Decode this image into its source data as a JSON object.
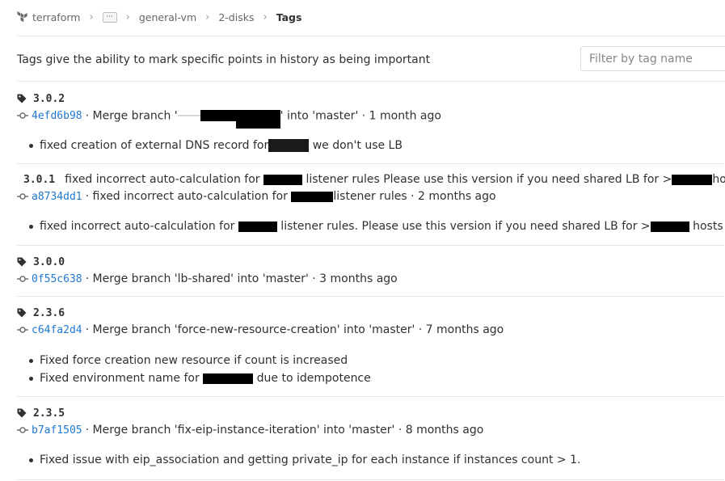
{
  "breadcrumb": {
    "root": "terraform",
    "more": "···",
    "items": [
      "general-vm",
      "2-disks"
    ],
    "current": "Tags"
  },
  "intro": "Tags give the ability to mark specific points in history as being important",
  "filter": {
    "placeholder": "Filter by tag name",
    "value": ""
  },
  "tags": [
    {
      "name": "3.0.2",
      "message": "",
      "sha": "4efd6b98",
      "commit_pre": "· Merge branch '",
      "commit_post": "' into 'master' · 1 month ago",
      "notes": [
        {
          "pre": "fixed creation of external DNS record for",
          "post": " we don't use LB"
        }
      ]
    },
    {
      "name": "3.0.1",
      "message_pre": "fixed incorrect auto-calculation for ",
      "message_mid": " listener rules Please use this version if you need shared LB for >",
      "message_post": "hosts",
      "sha": "a8734dd1",
      "commit_pre": "· fixed incorrect auto-calculation for ",
      "commit_post": "listener rules · 2 months ago",
      "notes": [
        {
          "pre": "fixed incorrect auto-calculation for ",
          "mid": " listener rules. Please use this version if you need shared LB for >",
          "post": " hosts"
        }
      ]
    },
    {
      "name": "3.0.0",
      "sha": "0f55c638",
      "commit_text": "· Merge branch 'lb-shared' into 'master' · 3 months ago"
    },
    {
      "name": "2.3.6",
      "sha": "c64fa2d4",
      "commit_text": "· Merge branch 'force-new-resource-creation' into 'master' · 7 months ago",
      "notes": [
        {
          "text": "Fixed force creation new resource if count is increased"
        },
        {
          "pre": "Fixed environment name for ",
          "post": " due to idempotence"
        }
      ]
    },
    {
      "name": "2.3.5",
      "sha": "b7af1505",
      "commit_text": "· Merge branch 'fix-eip-instance-iteration' into 'master' · 8 months ago",
      "notes": [
        {
          "text": "Fixed issue with eip_association and getting private_ip for each instance if instances count > 1."
        }
      ]
    }
  ],
  "colors": {
    "link": "#1f78d1",
    "text": "#303030",
    "muted": "#666666",
    "border": "#e5e5e5"
  }
}
